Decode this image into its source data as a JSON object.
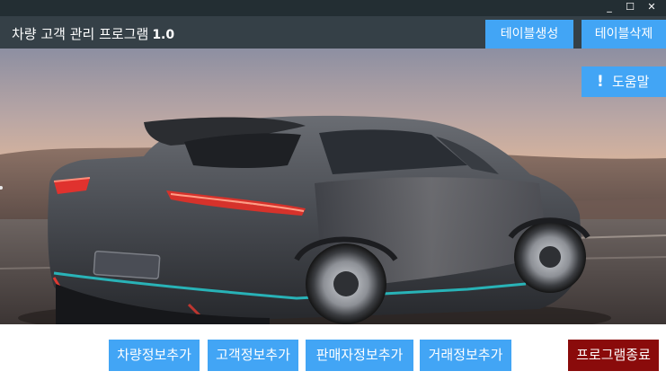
{
  "window": {
    "minimize_icon": "minimize-icon",
    "maximize_icon": "maximize-icon",
    "close_icon": "close-icon",
    "minimize_glyph": "_",
    "maximize_glyph": "☐",
    "close_glyph": "✕"
  },
  "header": {
    "title": "차량 고객 관리 프로그램",
    "version": "1.0",
    "create_table_label": "테이블생성",
    "delete_table_label": "테이블삭제"
  },
  "help": {
    "icon": "exclamation-icon",
    "glyph": "!",
    "label": "도움말"
  },
  "hero": {
    "description_icon": "car-photo"
  },
  "actions": {
    "add_vehicle_label": "차량정보추가",
    "add_customer_label": "고객정보추가",
    "add_seller_label": "판매자정보추가",
    "add_transaction_label": "거래정보추가",
    "exit_label": "프로그램종료"
  },
  "colors": {
    "titlebar": "#232e33",
    "header": "#354047",
    "accent": "#42a5f5",
    "exit": "#8a0b0b"
  }
}
